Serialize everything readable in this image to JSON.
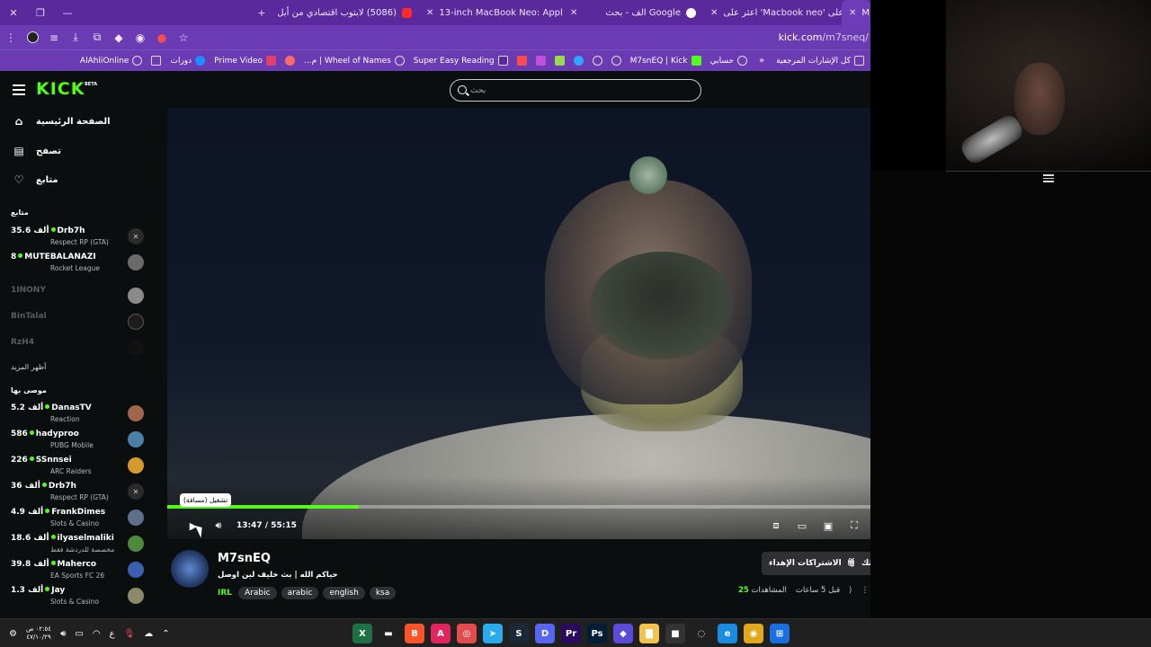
{
  "tabs": [
    {
      "title": "M",
      "favicon_color": "#53fc18",
      "active": true
    },
    {
      "title": "اعثر على 'Macbook neo' على ...k",
      "favicon_color": "#111111"
    },
    {
      "title": "الف - بحث Google",
      "favicon_color": "#ffffff"
    },
    {
      "title": "13-inch MacBook Neo: Apple A...",
      "favicon_color": "#2ea043"
    },
    {
      "title": "(5086) لابتوب اقتصادي من أبل ...",
      "favicon_color": "#ff2b2b"
    }
  ],
  "address_bar": {
    "url_host": "kick.com",
    "url_path": "/m7sneq/"
  },
  "bookmarks": [
    {
      "label": "كل الإشارات المرجعية",
      "color": "#c7c7c7"
    },
    {
      "label": "حسابي",
      "color": "#c7c7c7"
    },
    {
      "label": "M7snEQ | Kick",
      "color": "#53fc18"
    },
    {
      "label": "",
      "color": "#c7c7c7"
    },
    {
      "label": "",
      "color": "#c7c7c7"
    },
    {
      "label": "",
      "color": "#2ea7ff"
    },
    {
      "label": "",
      "color": "#9bd84f"
    },
    {
      "label": "",
      "color": "#c44fd8"
    },
    {
      "label": "",
      "color": "#ff4b4b"
    },
    {
      "label": "Super Easy Reading",
      "color": "#5a2a9c"
    },
    {
      "label": "Wheel of Names | م...",
      "color": "#c7c7c7"
    },
    {
      "label": "",
      "color": "#ff6b6b"
    },
    {
      "label": "Prime Video",
      "color": "#e2416b"
    },
    {
      "label": "دورات",
      "color": "#1f8fff"
    },
    {
      "label": "",
      "color": "#c7c7c7"
    },
    {
      "label": "AlAhliOnline",
      "color": "#c7c7c7"
    }
  ],
  "kick": {
    "logo": "KICK",
    "beta": "BETA",
    "search_placeholder": "بحث",
    "nav": [
      {
        "label": "الصفحة الرئيسية",
        "icon": "home-icon",
        "glyph": "⌂"
      },
      {
        "label": "تصفح",
        "icon": "browse-icon",
        "glyph": "▤"
      },
      {
        "label": "متابع",
        "icon": "heart-icon",
        "glyph": "♡"
      }
    ],
    "following_title": "متابع",
    "following": [
      {
        "name": "Drb7h",
        "viewers": "35.6 ألف",
        "game": "Respect RP (GTA)",
        "live": true
      },
      {
        "name": "MUTEBALANAZI",
        "viewers": "8",
        "game": "Rocket League",
        "live": true
      },
      {
        "name": "1INONY",
        "live": false
      },
      {
        "name": "BinTalal",
        "live": false
      },
      {
        "name": "RzH4",
        "live": false
      }
    ],
    "show_more": "أظهر المزيد",
    "recommended_title": "موصى بها",
    "recommended": [
      {
        "name": "DanasTV",
        "viewers": "5.2 ألف",
        "game": "Reaction"
      },
      {
        "name": "hadyproo",
        "viewers": "586",
        "game": "PUBG Mobile"
      },
      {
        "name": "SSnnsei",
        "viewers": "226",
        "game": "ARC Raiders"
      },
      {
        "name": "Drb7h",
        "viewers": "36 ألف",
        "game": "Respect RP (GTA)"
      },
      {
        "name": "FrankDimes",
        "viewers": "4.9 ألف",
        "game": "Slots & Casino"
      },
      {
        "name": "ilyaselmaliki",
        "viewers": "18.6 ألف",
        "game": "مخصصة للدردشة فقط"
      },
      {
        "name": "Maherco",
        "viewers": "39.8 ألف",
        "game": "EA Sports FC 26"
      },
      {
        "name": "Jay",
        "viewers": "1.3 ألف",
        "game": "Slots & Casino"
      }
    ],
    "player": {
      "tooltip": "تشغيل (مسافة)",
      "current_time": "13:47",
      "duration": "55:15",
      "progress_fraction": 0.2495
    },
    "channel": {
      "name": "M7snEQ",
      "title": "حياكم الله | بث خليف لين اوصل",
      "category": "IRL",
      "tags": [
        "Arabic",
        "arabic",
        "english",
        "ksa"
      ],
      "subscriptions_label": "الاشتراكات الإهداء",
      "customize_label": "تخصيص قناتك",
      "views_label": "المشاهدات",
      "views_count": "25",
      "time_ago": "قبل 5 ساعات"
    }
  },
  "taskbar": {
    "clock_time": "٠٢:٥٤ ص",
    "clock_date": "٤٧/١٠/٢٩",
    "lang": "ع",
    "apps": [
      {
        "label": "X",
        "color": "#1e7145"
      },
      {
        "label": "▬",
        "color": "#202020"
      },
      {
        "label": "B",
        "color": "#fb542b"
      },
      {
        "label": "A",
        "color": "#e0245e"
      },
      {
        "label": "◎",
        "color": "#e34c4c"
      },
      {
        "label": "➤",
        "color": "#2aabee"
      },
      {
        "label": "S",
        "color": "#1b2838"
      },
      {
        "label": "D",
        "color": "#5865f2"
      },
      {
        "label": "Pr",
        "color": "#2a0a5e"
      },
      {
        "label": "Ps",
        "color": "#001e36"
      },
      {
        "label": "◆",
        "color": "#5b4bd6"
      },
      {
        "label": "▇",
        "color": "#f3c44b"
      },
      {
        "label": "■",
        "color": "#333333"
      },
      {
        "label": "◌",
        "color": "#202020"
      },
      {
        "label": "e",
        "color": "#1a8de0"
      },
      {
        "label": "◉",
        "color": "#e0a81a"
      },
      {
        "label": "⊞",
        "color": "#1a6fe0"
      }
    ]
  },
  "colors": {
    "kick_green": "#53fc18",
    "browser_purple": "#6b3bb3",
    "page_bg": "#0b0e0f"
  }
}
